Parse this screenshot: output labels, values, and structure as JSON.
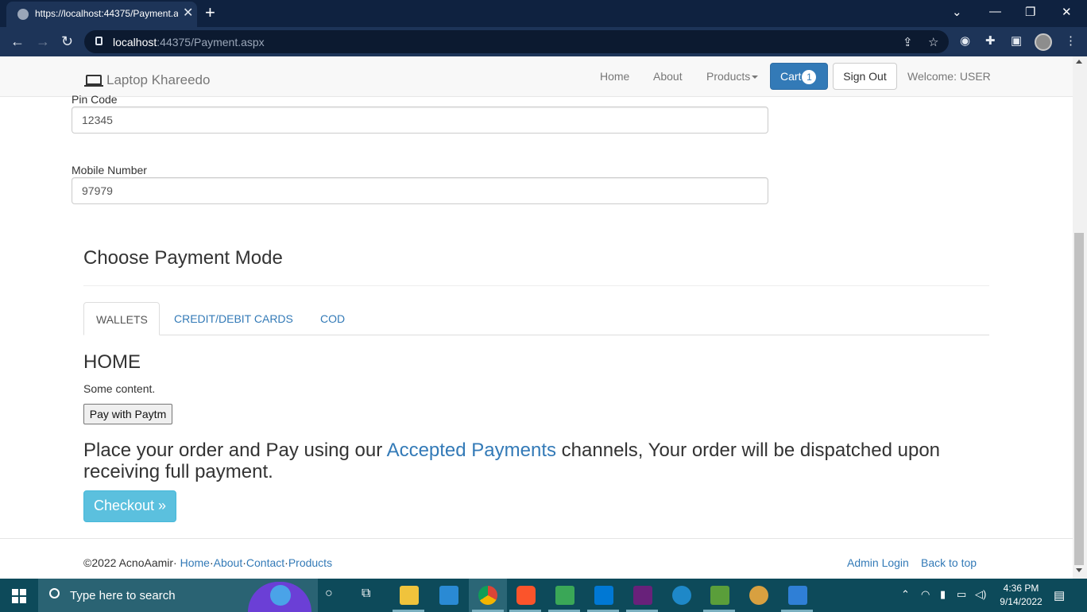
{
  "browser": {
    "tab_title": "https://localhost:44375/Payment.aspx",
    "url_host": "localhost",
    "url_rest": ":44375/Payment.aspx"
  },
  "site": {
    "brand": "Laptop Khareedo",
    "nav": {
      "home": "Home",
      "about": "About",
      "products": "Products",
      "cart": "Cart",
      "cart_count": "1",
      "sign_out": "Sign Out",
      "welcome": "Welcome: USER"
    }
  },
  "form": {
    "pin_code_label": "Pin Code",
    "pin_code_value": "12345",
    "mobile_label": "Mobile Number",
    "mobile_value": "97979"
  },
  "payment": {
    "title": "Choose Payment Mode",
    "tabs": [
      "WALLETS",
      "CREDIT/DEBIT CARDS",
      "COD"
    ],
    "active_tab": "WALLETS",
    "tab_heading": "HOME",
    "tab_text": "Some content.",
    "paytm_button": "Pay with Paytm",
    "lead_prefix": "Place your order and Pay using our ",
    "lead_link": "Accepted Payments",
    "lead_suffix": " channels, Your order will be dispatched upon receiving full payment.",
    "checkout_button": "Checkout »"
  },
  "footer": {
    "copyright": "©2022 AcnoAamir·",
    "links": [
      "Home",
      "About",
      "Contact",
      "Products"
    ],
    "admin_login": "Admin Login",
    "back_to_top": "Back to top"
  },
  "taskbar": {
    "search_placeholder": "Type here to search",
    "time": "4:36 PM",
    "date": "9/14/2022"
  },
  "colors": {
    "primary": "#337ab7",
    "info": "#5bc0de",
    "taskbar": "#0d4a5a",
    "chrome_frame": "#0f2240"
  }
}
